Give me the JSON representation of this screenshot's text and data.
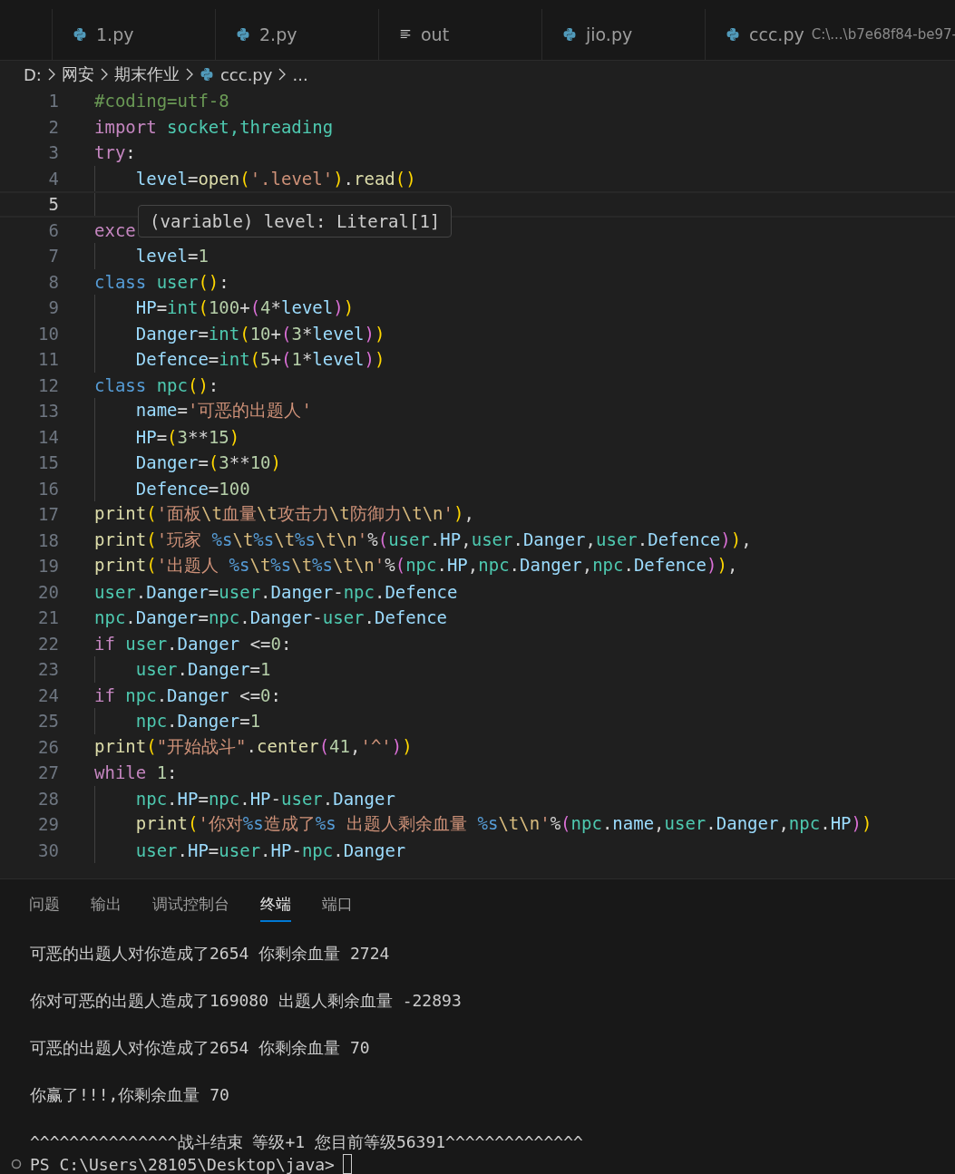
{
  "tabs": [
    {
      "label": "1.py",
      "kind": "python"
    },
    {
      "label": "2.py",
      "kind": "python"
    },
    {
      "label": "out",
      "kind": "text"
    },
    {
      "label": "jio.py",
      "kind": "python"
    },
    {
      "label": "ccc.py",
      "kind": "python",
      "description": "C:\\...\\b7e68f84-be97-"
    }
  ],
  "breadcrumb": [
    {
      "label": "D:",
      "kind": "folder"
    },
    {
      "label": "网安",
      "kind": "folder"
    },
    {
      "label": "期末作业",
      "kind": "folder"
    },
    {
      "label": "ccc.py",
      "kind": "python"
    },
    {
      "label": "...",
      "kind": "more"
    }
  ],
  "editor": {
    "lines": [
      {
        "number": "1",
        "current": false,
        "tokens": [
          {
            "kind": "cmt",
            "text": "#coding=utf-8"
          }
        ]
      },
      {
        "number": "2",
        "current": false,
        "tokens": [
          {
            "kind": "kw",
            "text": "import "
          },
          {
            "kind": "mod",
            "text": "socket,threading"
          }
        ]
      },
      {
        "number": "3",
        "current": false,
        "tokens": [
          {
            "kind": "kw",
            "text": "try"
          },
          {
            "kind": "op",
            "text": ":"
          }
        ],
        "children": [
          {
            "number": "4",
            "current": false,
            "tokens": [
              {
                "kind": "var",
                "text": "level"
              },
              {
                "kind": "op",
                "text": "="
              },
              {
                "kind": "fn",
                "text": "open"
              },
              {
                "kind": "b1",
                "text": "("
              },
              {
                "kind": "str",
                "text": "'.level'"
              },
              {
                "kind": "b1",
                "text": ")"
              },
              {
                "kind": "op",
                "text": "."
              },
              {
                "kind": "fn",
                "text": "read"
              },
              {
                "kind": "b1",
                "text": "()"
              }
            ]
          },
          {
            "number": "5",
            "current": true
          }
        ]
      },
      {
        "number": "6",
        "current": false,
        "tokens": [
          {
            "kind": "kw",
            "text": "exce"
          }
        ],
        "children": [
          {
            "number": "7",
            "current": false,
            "tokens": [
              {
                "kind": "var",
                "text": "level"
              },
              {
                "kind": "op",
                "text": "="
              },
              {
                "kind": "num",
                "text": "1"
              }
            ]
          }
        ]
      },
      {
        "number": "8",
        "current": false,
        "tokens": [
          {
            "kind": "cls",
            "text": "class "
          },
          {
            "kind": "mod",
            "text": "user"
          },
          {
            "kind": "b1",
            "text": "()"
          },
          {
            "kind": "op",
            "text": ":"
          }
        ],
        "children": [
          {
            "number": "9",
            "current": false,
            "tokens": [
              {
                "kind": "var",
                "text": "HP"
              },
              {
                "kind": "op",
                "text": "="
              },
              {
                "kind": "mod",
                "text": "int"
              },
              {
                "kind": "b1",
                "text": "("
              },
              {
                "kind": "num",
                "text": "100"
              },
              {
                "kind": "op",
                "text": "+"
              },
              {
                "kind": "b2",
                "text": "("
              },
              {
                "kind": "num",
                "text": "4"
              },
              {
                "kind": "op",
                "text": "*"
              },
              {
                "kind": "var",
                "text": "level"
              },
              {
                "kind": "b2",
                "text": ")"
              },
              {
                "kind": "b1",
                "text": ")"
              }
            ]
          },
          {
            "number": "10",
            "current": false,
            "tokens": [
              {
                "kind": "var",
                "text": "Danger"
              },
              {
                "kind": "op",
                "text": "="
              },
              {
                "kind": "mod",
                "text": "int"
              },
              {
                "kind": "b1",
                "text": "("
              },
              {
                "kind": "num",
                "text": "10"
              },
              {
                "kind": "op",
                "text": "+"
              },
              {
                "kind": "b2",
                "text": "("
              },
              {
                "kind": "num",
                "text": "3"
              },
              {
                "kind": "op",
                "text": "*"
              },
              {
                "kind": "var",
                "text": "level"
              },
              {
                "kind": "b2",
                "text": ")"
              },
              {
                "kind": "b1",
                "text": ")"
              }
            ]
          },
          {
            "number": "11",
            "current": false,
            "tokens": [
              {
                "kind": "var",
                "text": "Defence"
              },
              {
                "kind": "op",
                "text": "="
              },
              {
                "kind": "mod",
                "text": "int"
              },
              {
                "kind": "b1",
                "text": "("
              },
              {
                "kind": "num",
                "text": "5"
              },
              {
                "kind": "op",
                "text": "+"
              },
              {
                "kind": "b2",
                "text": "("
              },
              {
                "kind": "num",
                "text": "1"
              },
              {
                "kind": "op",
                "text": "*"
              },
              {
                "kind": "var",
                "text": "level"
              },
              {
                "kind": "b2",
                "text": ")"
              },
              {
                "kind": "b1",
                "text": ")"
              }
            ]
          }
        ]
      },
      {
        "number": "12",
        "current": false,
        "tokens": [
          {
            "kind": "cls",
            "text": "class "
          },
          {
            "kind": "mod",
            "text": "npc"
          },
          {
            "kind": "b1",
            "text": "()"
          },
          {
            "kind": "op",
            "text": ":"
          }
        ],
        "children": [
          {
            "number": "13",
            "current": false,
            "tokens": [
              {
                "kind": "var",
                "text": "name"
              },
              {
                "kind": "op",
                "text": "="
              },
              {
                "kind": "str",
                "text": "'可恶的出题人'"
              }
            ]
          },
          {
            "number": "14",
            "current": false,
            "tokens": [
              {
                "kind": "var",
                "text": "HP"
              },
              {
                "kind": "op",
                "text": "="
              },
              {
                "kind": "b1",
                "text": "("
              },
              {
                "kind": "num",
                "text": "3"
              },
              {
                "kind": "op",
                "text": "**"
              },
              {
                "kind": "num",
                "text": "15"
              },
              {
                "kind": "b1",
                "text": ")"
              }
            ]
          },
          {
            "number": "15",
            "current": false,
            "tokens": [
              {
                "kind": "var",
                "text": "Danger"
              },
              {
                "kind": "op",
                "text": "="
              },
              {
                "kind": "b1",
                "text": "("
              },
              {
                "kind": "num",
                "text": "3"
              },
              {
                "kind": "op",
                "text": "**"
              },
              {
                "kind": "num",
                "text": "10"
              },
              {
                "kind": "b1",
                "text": ")"
              }
            ]
          },
          {
            "number": "16",
            "current": false,
            "tokens": [
              {
                "kind": "var",
                "text": "Defence"
              },
              {
                "kind": "op",
                "text": "="
              },
              {
                "kind": "num",
                "text": "100"
              }
            ]
          }
        ]
      },
      {
        "number": "17",
        "current": false,
        "tokens": [
          {
            "kind": "fn",
            "text": "print"
          },
          {
            "kind": "b1",
            "text": "("
          },
          {
            "kind": "str",
            "text": "'面板"
          },
          {
            "kind": "esc",
            "text": "\\t"
          },
          {
            "kind": "str",
            "text": "血量"
          },
          {
            "kind": "esc",
            "text": "\\t"
          },
          {
            "kind": "str",
            "text": "攻击力"
          },
          {
            "kind": "esc",
            "text": "\\t"
          },
          {
            "kind": "str",
            "text": "防御力"
          },
          {
            "kind": "esc",
            "text": "\\t\\n"
          },
          {
            "kind": "str",
            "text": "'"
          },
          {
            "kind": "b1",
            "text": ")"
          },
          {
            "kind": "op",
            "text": ","
          }
        ]
      },
      {
        "number": "18",
        "current": false,
        "tokens": [
          {
            "kind": "fn",
            "text": "print"
          },
          {
            "kind": "b1",
            "text": "("
          },
          {
            "kind": "str",
            "text": "'玩家 "
          },
          {
            "kind": "fmt",
            "text": "%s"
          },
          {
            "kind": "esc",
            "text": "\\t"
          },
          {
            "kind": "fmt",
            "text": "%s"
          },
          {
            "kind": "esc",
            "text": "\\t"
          },
          {
            "kind": "fmt",
            "text": "%s"
          },
          {
            "kind": "esc",
            "text": "\\t\\n"
          },
          {
            "kind": "str",
            "text": "'"
          },
          {
            "kind": "op",
            "text": "%"
          },
          {
            "kind": "b2",
            "text": "("
          },
          {
            "kind": "mod",
            "text": "user"
          },
          {
            "kind": "op",
            "text": "."
          },
          {
            "kind": "var",
            "text": "HP"
          },
          {
            "kind": "op",
            "text": ","
          },
          {
            "kind": "mod",
            "text": "user"
          },
          {
            "kind": "op",
            "text": "."
          },
          {
            "kind": "var",
            "text": "Danger"
          },
          {
            "kind": "op",
            "text": ","
          },
          {
            "kind": "mod",
            "text": "user"
          },
          {
            "kind": "op",
            "text": "."
          },
          {
            "kind": "var",
            "text": "Defence"
          },
          {
            "kind": "b2",
            "text": ")"
          },
          {
            "kind": "b1",
            "text": ")"
          },
          {
            "kind": "op",
            "text": ","
          }
        ]
      },
      {
        "number": "19",
        "current": false,
        "tokens": [
          {
            "kind": "fn",
            "text": "print"
          },
          {
            "kind": "b1",
            "text": "("
          },
          {
            "kind": "str",
            "text": "'出题人 "
          },
          {
            "kind": "fmt",
            "text": "%s"
          },
          {
            "kind": "esc",
            "text": "\\t"
          },
          {
            "kind": "fmt",
            "text": "%s"
          },
          {
            "kind": "esc",
            "text": "\\t"
          },
          {
            "kind": "fmt",
            "text": "%s"
          },
          {
            "kind": "esc",
            "text": "\\t\\n"
          },
          {
            "kind": "str",
            "text": "'"
          },
          {
            "kind": "op",
            "text": "%"
          },
          {
            "kind": "b2",
            "text": "("
          },
          {
            "kind": "mod",
            "text": "npc"
          },
          {
            "kind": "op",
            "text": "."
          },
          {
            "kind": "var",
            "text": "HP"
          },
          {
            "kind": "op",
            "text": ","
          },
          {
            "kind": "mod",
            "text": "npc"
          },
          {
            "kind": "op",
            "text": "."
          },
          {
            "kind": "var",
            "text": "Danger"
          },
          {
            "kind": "op",
            "text": ","
          },
          {
            "kind": "mod",
            "text": "npc"
          },
          {
            "kind": "op",
            "text": "."
          },
          {
            "kind": "var",
            "text": "Defence"
          },
          {
            "kind": "b2",
            "text": ")"
          },
          {
            "kind": "b1",
            "text": ")"
          },
          {
            "kind": "op",
            "text": ","
          }
        ]
      },
      {
        "number": "20",
        "current": false,
        "tokens": [
          {
            "kind": "mod",
            "text": "user"
          },
          {
            "kind": "op",
            "text": "."
          },
          {
            "kind": "var",
            "text": "Danger"
          },
          {
            "kind": "op",
            "text": "="
          },
          {
            "kind": "mod",
            "text": "user"
          },
          {
            "kind": "op",
            "text": "."
          },
          {
            "kind": "var",
            "text": "Danger"
          },
          {
            "kind": "op",
            "text": "-"
          },
          {
            "kind": "mod",
            "text": "npc"
          },
          {
            "kind": "op",
            "text": "."
          },
          {
            "kind": "var",
            "text": "Defence"
          }
        ]
      },
      {
        "number": "21",
        "current": false,
        "tokens": [
          {
            "kind": "mod",
            "text": "npc"
          },
          {
            "kind": "op",
            "text": "."
          },
          {
            "kind": "var",
            "text": "Danger"
          },
          {
            "kind": "op",
            "text": "="
          },
          {
            "kind": "mod",
            "text": "npc"
          },
          {
            "kind": "op",
            "text": "."
          },
          {
            "kind": "var",
            "text": "Danger"
          },
          {
            "kind": "op",
            "text": "-"
          },
          {
            "kind": "mod",
            "text": "user"
          },
          {
            "kind": "op",
            "text": "."
          },
          {
            "kind": "var",
            "text": "Defence"
          }
        ]
      },
      {
        "number": "22",
        "current": false,
        "tokens": [
          {
            "kind": "kw",
            "text": "if "
          },
          {
            "kind": "mod",
            "text": "user"
          },
          {
            "kind": "op",
            "text": "."
          },
          {
            "kind": "var",
            "text": "Danger"
          },
          {
            "kind": "op",
            "text": " <="
          },
          {
            "kind": "num",
            "text": "0"
          },
          {
            "kind": "op",
            "text": ":"
          }
        ],
        "children": [
          {
            "number": "23",
            "current": false,
            "tokens": [
              {
                "kind": "mod",
                "text": "user"
              },
              {
                "kind": "op",
                "text": "."
              },
              {
                "kind": "var",
                "text": "Danger"
              },
              {
                "kind": "op",
                "text": "="
              },
              {
                "kind": "num",
                "text": "1"
              }
            ]
          }
        ]
      },
      {
        "number": "24",
        "current": false,
        "tokens": [
          {
            "kind": "kw",
            "text": "if "
          },
          {
            "kind": "mod",
            "text": "npc"
          },
          {
            "kind": "op",
            "text": "."
          },
          {
            "kind": "var",
            "text": "Danger"
          },
          {
            "kind": "op",
            "text": " <="
          },
          {
            "kind": "num",
            "text": "0"
          },
          {
            "kind": "op",
            "text": ":"
          }
        ],
        "children": [
          {
            "number": "25",
            "current": false,
            "tokens": [
              {
                "kind": "mod",
                "text": "npc"
              },
              {
                "kind": "op",
                "text": "."
              },
              {
                "kind": "var",
                "text": "Danger"
              },
              {
                "kind": "op",
                "text": "="
              },
              {
                "kind": "num",
                "text": "1"
              }
            ]
          }
        ]
      },
      {
        "number": "26",
        "current": false,
        "tokens": [
          {
            "kind": "fn",
            "text": "print"
          },
          {
            "kind": "b1",
            "text": "("
          },
          {
            "kind": "str",
            "text": "\"开始战斗\""
          },
          {
            "kind": "op",
            "text": "."
          },
          {
            "kind": "fn",
            "text": "center"
          },
          {
            "kind": "b2",
            "text": "("
          },
          {
            "kind": "num",
            "text": "41"
          },
          {
            "kind": "op",
            "text": ","
          },
          {
            "kind": "str",
            "text": "'^'"
          },
          {
            "kind": "b2",
            "text": ")"
          },
          {
            "kind": "b1",
            "text": ")"
          }
        ]
      },
      {
        "number": "27",
        "current": false,
        "tokens": [
          {
            "kind": "kw",
            "text": "while "
          },
          {
            "kind": "num",
            "text": "1"
          },
          {
            "kind": "op",
            "text": ":"
          }
        ],
        "children": [
          {
            "number": "28",
            "current": false,
            "tokens": [
              {
                "kind": "mod",
                "text": "npc"
              },
              {
                "kind": "op",
                "text": "."
              },
              {
                "kind": "var",
                "text": "HP"
              },
              {
                "kind": "op",
                "text": "="
              },
              {
                "kind": "mod",
                "text": "npc"
              },
              {
                "kind": "op",
                "text": "."
              },
              {
                "kind": "var",
                "text": "HP"
              },
              {
                "kind": "op",
                "text": "-"
              },
              {
                "kind": "mod",
                "text": "user"
              },
              {
                "kind": "op",
                "text": "."
              },
              {
                "kind": "var",
                "text": "Danger"
              }
            ]
          },
          {
            "number": "29",
            "current": false,
            "tokens": [
              {
                "kind": "fn",
                "text": "print"
              },
              {
                "kind": "b1",
                "text": "("
              },
              {
                "kind": "str",
                "text": "'你对"
              },
              {
                "kind": "fmt",
                "text": "%s"
              },
              {
                "kind": "str",
                "text": "造成了"
              },
              {
                "kind": "fmt",
                "text": "%s"
              },
              {
                "kind": "str",
                "text": " 出题人剩余血量 "
              },
              {
                "kind": "fmt",
                "text": "%s"
              },
              {
                "kind": "esc",
                "text": "\\t\\n"
              },
              {
                "kind": "str",
                "text": "'"
              },
              {
                "kind": "op",
                "text": "%"
              },
              {
                "kind": "b2",
                "text": "("
              },
              {
                "kind": "mod",
                "text": "npc"
              },
              {
                "kind": "op",
                "text": "."
              },
              {
                "kind": "var",
                "text": "name"
              },
              {
                "kind": "op",
                "text": ","
              },
              {
                "kind": "mod",
                "text": "user"
              },
              {
                "kind": "op",
                "text": "."
              },
              {
                "kind": "var",
                "text": "Danger"
              },
              {
                "kind": "op",
                "text": ","
              },
              {
                "kind": "mod",
                "text": "npc"
              },
              {
                "kind": "op",
                "text": "."
              },
              {
                "kind": "var",
                "text": "HP"
              },
              {
                "kind": "b2",
                "text": ")"
              },
              {
                "kind": "b1",
                "text": ")"
              }
            ]
          },
          {
            "number": "30",
            "current": false,
            "tokens": [
              {
                "kind": "mod",
                "text": "user"
              },
              {
                "kind": "op",
                "text": "."
              },
              {
                "kind": "var",
                "text": "HP"
              },
              {
                "kind": "op",
                "text": "="
              },
              {
                "kind": "mod",
                "text": "user"
              },
              {
                "kind": "op",
                "text": "."
              },
              {
                "kind": "var",
                "text": "HP"
              },
              {
                "kind": "op",
                "text": "-"
              },
              {
                "kind": "mod",
                "text": "npc"
              },
              {
                "kind": "op",
                "text": "."
              },
              {
                "kind": "var",
                "text": "Danger"
              }
            ]
          }
        ]
      }
    ],
    "hover_tooltip": "(variable) level: Literal[1]"
  },
  "panel": {
    "tabs": [
      {
        "label": "问题",
        "selected": false
      },
      {
        "label": "输出",
        "selected": false
      },
      {
        "label": "调试控制台",
        "selected": false
      },
      {
        "label": "终端",
        "selected": true
      },
      {
        "label": "端口",
        "selected": false
      }
    ],
    "terminal_lines": [
      "可恶的出题人对你造成了2654 你剩余血量 2724",
      "你对可恶的出题人造成了169080 出题人剩余血量 -22893",
      "可恶的出题人对你造成了2654 你剩余血量 70",
      "你赢了!!!,你剩余血量 70",
      "^^^^^^^^^^^^^^^战斗结束 等级+1 您目前等级56391^^^^^^^^^^^^^^"
    ],
    "prompt": "PS C:\\Users\\28105\\Desktop\\java>"
  }
}
